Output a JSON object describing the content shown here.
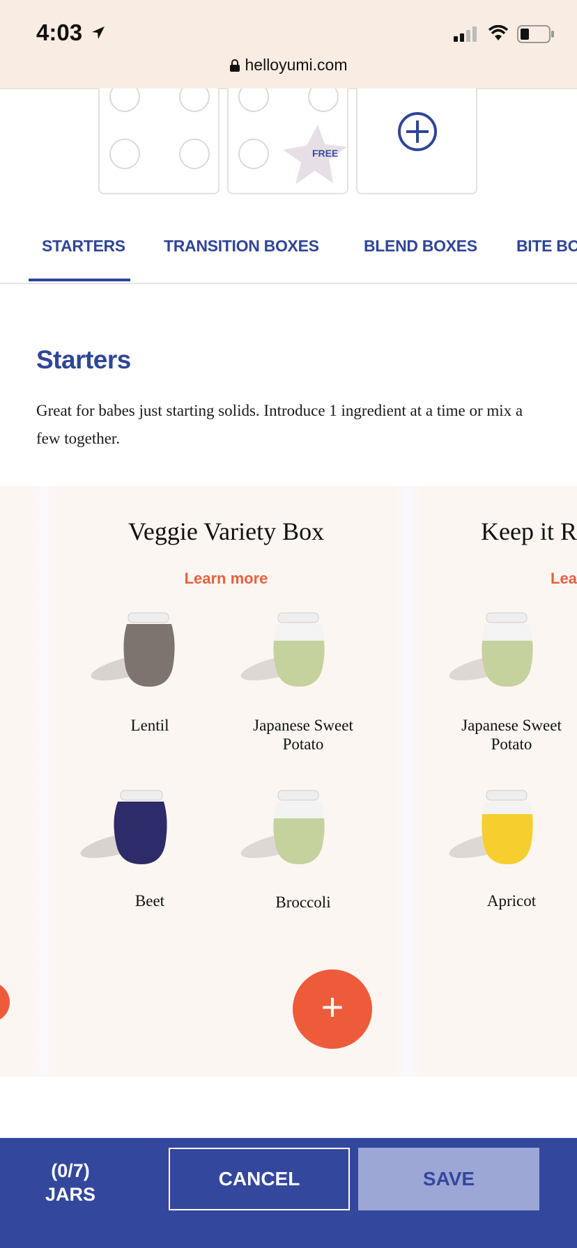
{
  "status_bar": {
    "time": "4:03",
    "url": "helloyumi.com"
  },
  "slots": {
    "free_label": "FREE"
  },
  "tabs": [
    {
      "label": "STARTERS"
    },
    {
      "label": "TRANSITION BOXES"
    },
    {
      "label": "BLEND BOXES"
    },
    {
      "label": "BITE BOX"
    }
  ],
  "section": {
    "title": "Starters",
    "description": "Great for babes just starting solids. Introduce 1 ingredient at a time or mix a few together."
  },
  "cards": [
    {
      "title": "Veggie Variety Box",
      "learn_more": "Learn more",
      "items": [
        {
          "name": "Lentil",
          "color": "#7d736f"
        },
        {
          "name": "Japanese Sweet Potato",
          "color": "#c5d29d"
        },
        {
          "name": "Beet",
          "color": "#2d2b6a"
        },
        {
          "name": "Broccoli",
          "color": "#c5d29d"
        }
      ],
      "add_symbol": "+"
    },
    {
      "title": "Keep it R",
      "learn_more": "Lear",
      "items": [
        {
          "name": "Japanese Sweet Potato",
          "color": "#c5d29d"
        },
        {
          "name": "Apricot",
          "color": "#f6cf2e"
        }
      ]
    }
  ],
  "footer": {
    "jars_count": "(0/7)",
    "jars_label": "JARS",
    "cancel_label": "CANCEL",
    "save_label": "SAVE"
  },
  "colors": {
    "brand_blue": "#33479c",
    "accent_orange": "#ee5b3b"
  }
}
